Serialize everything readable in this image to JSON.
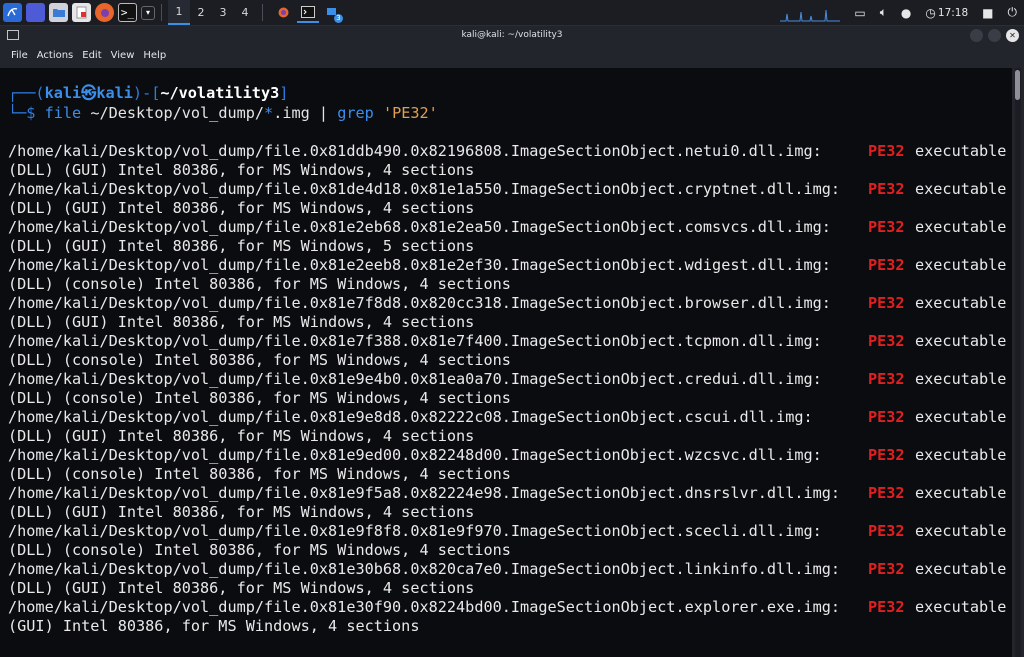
{
  "panel": {
    "workspaces": [
      "1",
      "2",
      "3",
      "4"
    ],
    "active_workspace": "1",
    "task_badge": "3",
    "clock": "17:18"
  },
  "window": {
    "title": "kali@kali: ~/volatility3",
    "menu": [
      "File",
      "Actions",
      "Edit",
      "View",
      "Help"
    ]
  },
  "terminal": {
    "prompt": {
      "open": "┌──(",
      "user": "kali㉿kali",
      "mid": ")-[",
      "path": "~/volatility3",
      "close": "]",
      "arrow": "└─$",
      "cmd_file": "file",
      "cmd_arg1": " ~/Desktop/vol_dump/",
      "cmd_star": "*",
      "cmd_arg2": ".img | ",
      "cmd_grep": "grep",
      "cmd_space": " ",
      "cmd_str": "'PE32'"
    },
    "rows": [
      {
        "path": "/home/kali/Desktop/vol_dump/file.0x81ddb490.0x82196808.ImageSectionObject.netui0.dll.img:",
        "match": "PE32",
        "type": "executable",
        "desc": "(DLL) (GUI) Intel 80386, for MS Windows, 4 sections"
      },
      {
        "path": "/home/kali/Desktop/vol_dump/file.0x81de4d18.0x81e1a550.ImageSectionObject.cryptnet.dll.img:",
        "match": "PE32",
        "type": "executable",
        "desc": "(DLL) (GUI) Intel 80386, for MS Windows, 4 sections"
      },
      {
        "path": "/home/kali/Desktop/vol_dump/file.0x81e2eb68.0x81e2ea50.ImageSectionObject.comsvcs.dll.img:",
        "match": "PE32",
        "type": "executable",
        "desc": "(DLL) (GUI) Intel 80386, for MS Windows, 5 sections"
      },
      {
        "path": "/home/kali/Desktop/vol_dump/file.0x81e2eeb8.0x81e2ef30.ImageSectionObject.wdigest.dll.img:",
        "match": "PE32",
        "type": "executable",
        "desc": "(DLL) (console) Intel 80386, for MS Windows, 4 sections"
      },
      {
        "path": "/home/kali/Desktop/vol_dump/file.0x81e7f8d8.0x820cc318.ImageSectionObject.browser.dll.img:",
        "match": "PE32",
        "type": "executable",
        "desc": "(DLL) (GUI) Intel 80386, for MS Windows, 4 sections"
      },
      {
        "path": "/home/kali/Desktop/vol_dump/file.0x81e7f388.0x81e7f400.ImageSectionObject.tcpmon.dll.img:",
        "match": "PE32",
        "type": "executable",
        "desc": "(DLL) (console) Intel 80386, for MS Windows, 4 sections"
      },
      {
        "path": "/home/kali/Desktop/vol_dump/file.0x81e9e4b0.0x81ea0a70.ImageSectionObject.credui.dll.img:",
        "match": "PE32",
        "type": "executable",
        "desc": "(DLL) (console) Intel 80386, for MS Windows, 4 sections"
      },
      {
        "path": "/home/kali/Desktop/vol_dump/file.0x81e9e8d8.0x82222c08.ImageSectionObject.cscui.dll.img:",
        "match": "PE32",
        "type": "executable",
        "desc": "(DLL) (GUI) Intel 80386, for MS Windows, 4 sections"
      },
      {
        "path": "/home/kali/Desktop/vol_dump/file.0x81e9ed00.0x82248d00.ImageSectionObject.wzcsvc.dll.img:",
        "match": "PE32",
        "type": "executable",
        "desc": "(DLL) (console) Intel 80386, for MS Windows, 4 sections"
      },
      {
        "path": "/home/kali/Desktop/vol_dump/file.0x81e9f5a8.0x82224e98.ImageSectionObject.dnsrslvr.dll.img:",
        "match": "PE32",
        "type": "executable",
        "desc": "(DLL) (GUI) Intel 80386, for MS Windows, 4 sections"
      },
      {
        "path": "/home/kali/Desktop/vol_dump/file.0x81e9f8f8.0x81e9f970.ImageSectionObject.scecli.dll.img:",
        "match": "PE32",
        "type": "executable",
        "desc": "(DLL) (console) Intel 80386, for MS Windows, 4 sections"
      },
      {
        "path": "/home/kali/Desktop/vol_dump/file.0x81e30b68.0x820ca7e0.ImageSectionObject.linkinfo.dll.img:",
        "match": "PE32",
        "type": "executable",
        "desc": "(DLL) (GUI) Intel 80386, for MS Windows, 4 sections"
      },
      {
        "path": "/home/kali/Desktop/vol_dump/file.0x81e30f90.0x8224bd00.ImageSectionObject.explorer.exe.img:",
        "match": "PE32",
        "type": "executable",
        "desc": "(GUI) Intel 80386, for MS Windows, 4 sections"
      }
    ]
  }
}
